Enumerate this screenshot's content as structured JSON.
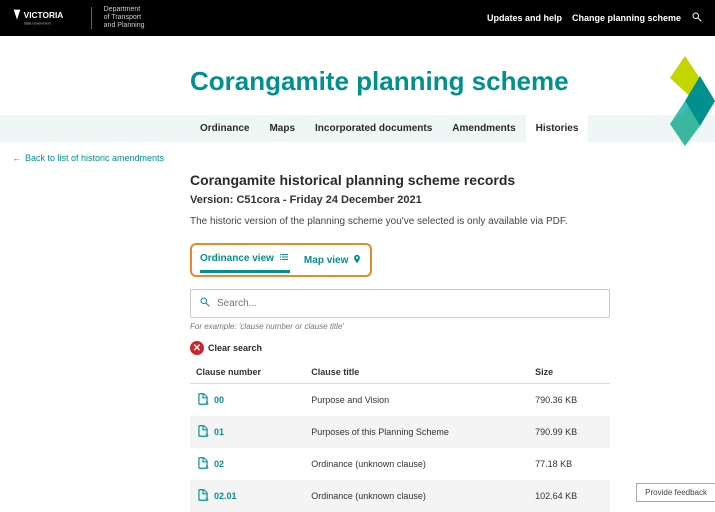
{
  "header": {
    "logo_text": "VICTORIA",
    "logo_sub": "State Government",
    "department": "Department\nof Transport\nand Planning",
    "updates_link": "Updates and help",
    "change_scheme_link": "Change planning scheme"
  },
  "hero": {
    "title": "Corangamite planning scheme"
  },
  "nav": {
    "items": [
      "Ordinance",
      "Maps",
      "Incorporated documents",
      "Amendments",
      "Histories"
    ],
    "active_index": 4
  },
  "breadcrumb": {
    "back_label": "Back to list of historic amendments"
  },
  "page": {
    "heading": "Corangamite historical planning scheme records",
    "version_label": "Version: C51cora - Friday 24 December 2021",
    "intro_text": "The historic version of the planning scheme you've selected is only available via PDF."
  },
  "view_tabs": {
    "ordinance": "Ordinance view",
    "map": "Map view"
  },
  "search": {
    "placeholder": "Search...",
    "example_hint": "For example: 'clause number or clause title'",
    "clear_label": "Clear search"
  },
  "table": {
    "columns": {
      "clause_number": "Clause number",
      "clause_title": "Clause title",
      "size": "Size"
    },
    "rows": [
      {
        "num": "00",
        "title": "Purpose and Vision",
        "size": "790.36 KB"
      },
      {
        "num": "01",
        "title": "Purposes of this Planning Scheme",
        "size": "790.99 KB"
      },
      {
        "num": "02",
        "title": "Ordinance (unknown clause)",
        "size": "77.18 KB"
      },
      {
        "num": "02.01",
        "title": "Ordinance (unknown clause)",
        "size": "102.64 KB"
      }
    ]
  },
  "feedback": {
    "label": "Provide feedback"
  }
}
